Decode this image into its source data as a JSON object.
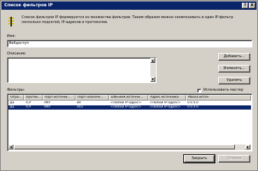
{
  "window": {
    "title": "Список фильтров IP",
    "help_btn": "?",
    "close_btn": "X"
  },
  "description": "Список фильтров IP формируется из множества фильтров. Таким образом можно скомпоновать в один IP-фильтр несколько подсетей, IP-адресов и протоколов.",
  "name": {
    "label": "Имя:",
    "value": "Вебдоступ"
  },
  "desc_field": {
    "label": "Описание:",
    "value": ""
  },
  "buttons": {
    "add": "Добавить...",
    "edit": "Изменить...",
    "remove": "Удалить",
    "close": "Закрыть",
    "cancel": "Отмена"
  },
  "filters": {
    "label": "Фильтры:",
    "wizard_checkbox": "Использовать мастер",
    "columns": [
      "Отра...",
      "Проток...",
      "Порт источни...",
      "Порт назначе...",
      "DNS-имя источни...",
      "Адрес источника",
      "Маска источ"
    ],
    "rows": [
      [
        "Да",
        "TCP",
        "ANY",
        "80",
        "<Любой IP-адрес>",
        "<Любой IP-адрес>",
        "0.0.0.0"
      ],
      [
        "Да",
        "TCP",
        "ANY",
        "443",
        "<Любой IP-адрес>",
        "<Любой IP-адрес>",
        "0.0.0.0"
      ]
    ]
  },
  "colors": {
    "titlebar": "#0a246a",
    "selection": "#0a246a",
    "face": "#d4d0c8"
  }
}
